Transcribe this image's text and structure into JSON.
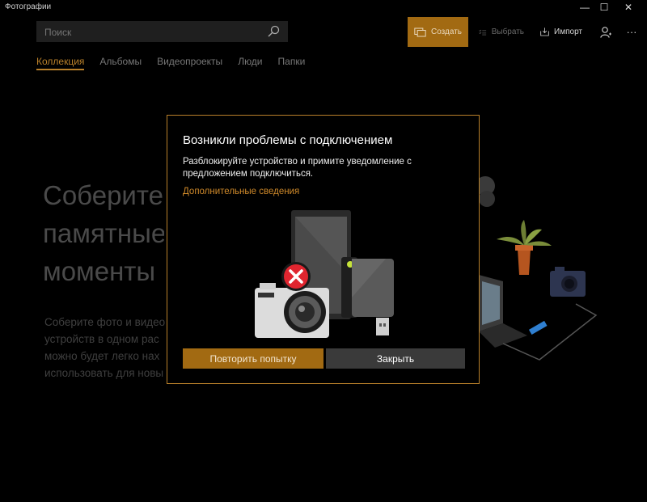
{
  "app": {
    "title": "Фотографии"
  },
  "window_controls": {
    "minimize": "—",
    "maximize": "☐",
    "close": "✕"
  },
  "search": {
    "placeholder": "Поиск"
  },
  "toolbar": {
    "create_label": "Создать",
    "select_label": "Выбрать",
    "import_label": "Импорт",
    "more_label": "···"
  },
  "tabs": [
    {
      "label": "Коллекция",
      "active": true
    },
    {
      "label": "Альбомы"
    },
    {
      "label": "Видеопроекты"
    },
    {
      "label": "Люди"
    },
    {
      "label": "Папки"
    }
  ],
  "hero": {
    "title": "Соберите\nпамятные\nмоменты",
    "body": "Соберите фото и видео\nустройств в одном рас\nможно будет легко нах\nиспользовать для новы"
  },
  "dialog": {
    "title": "Возникли проблемы с подключением",
    "message": "Разблокируйте устройство и примите уведомление с предложением подключиться.",
    "link": "Дополнительные сведения",
    "retry_label": "Повторить попытку",
    "close_label": "Закрыть"
  },
  "colors": {
    "accent": "#a26a12",
    "accent_text": "#b9802a",
    "link": "#d08a2a",
    "error": "#e0252f"
  }
}
